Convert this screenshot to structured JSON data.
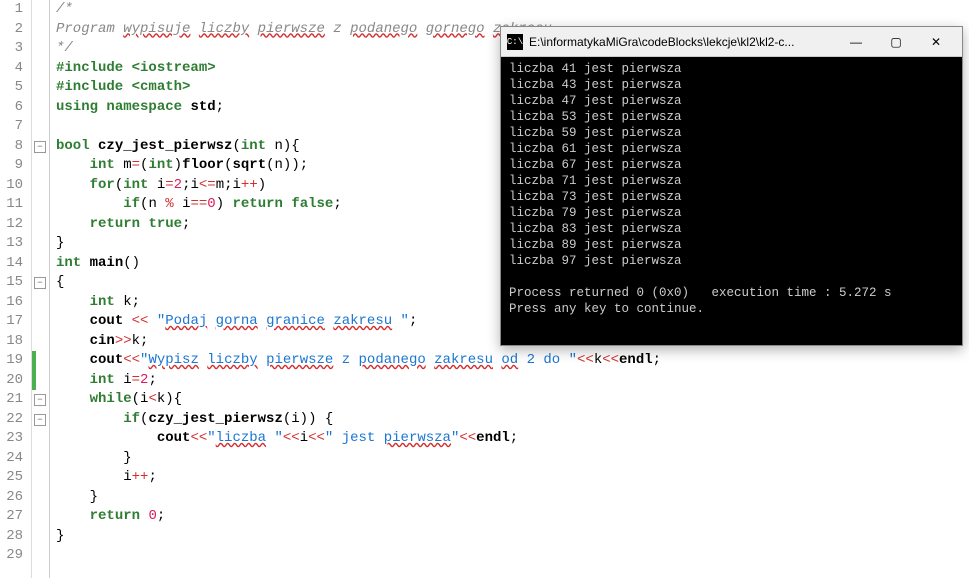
{
  "lines": [
    {
      "n": 1,
      "html": "<span class='c-comment'>/*</span>"
    },
    {
      "n": 2,
      "html": "<span class='c-comment'>Program <span class='c-spell'>wypisuje</span> <span class='c-spell'>liczby</span> <span class='c-spell'>pierwsze</span> z <span class='c-spell'>podanego</span> <span class='c-spell'>gornego</span> <span class='c-spell'>zakresu</span></span>"
    },
    {
      "n": 3,
      "html": "<span class='c-comment'>*/</span>"
    },
    {
      "n": 4,
      "html": "<span class='c-pre'>#include &lt;iostream&gt;</span>"
    },
    {
      "n": 5,
      "html": "<span class='c-pre'>#include &lt;cmath&gt;</span>"
    },
    {
      "n": 6,
      "html": "<span class='c-kw'>using</span> <span class='c-kw'>namespace</span> <span class='c-id' style='font-weight:bold'>std</span><span class='c-punc'>;</span>"
    },
    {
      "n": 7,
      "html": ""
    },
    {
      "n": 8,
      "fold": "⊟",
      "html": "<span class='c-kw'>bool</span> <span class='c-fn'>czy_jest_pierwsz</span><span class='c-punc'>(</span><span class='c-kw'>int</span> <span class='c-id'>n</span><span class='c-punc'>)</span><span class='c-punc'>{</span>"
    },
    {
      "n": 9,
      "html": "    <span class='c-kw'>int</span> <span class='c-id'>m</span><span class='c-op'>=</span><span class='c-punc'>(</span><span class='c-kw'>int</span><span class='c-punc'>)</span><span class='c-fn'>floor</span><span class='c-punc'>(</span><span class='c-fn'>sqrt</span><span class='c-punc'>(</span><span class='c-id'>n</span><span class='c-punc'>))</span><span class='c-punc'>;</span>"
    },
    {
      "n": 10,
      "html": "    <span class='c-kw'>for</span><span class='c-punc'>(</span><span class='c-kw'>int</span> <span class='c-id'>i</span><span class='c-op'>=</span><span class='c-num'>2</span><span class='c-punc'>;</span><span class='c-id'>i</span><span class='c-op'>&lt;=</span><span class='c-id'>m</span><span class='c-punc'>;</span><span class='c-id'>i</span><span class='c-op'>++</span><span class='c-punc'>)</span>"
    },
    {
      "n": 11,
      "html": "        <span class='c-kw'>if</span><span class='c-punc'>(</span><span class='c-id'>n</span> <span class='c-op'>%</span> <span class='c-id'>i</span><span class='c-op'>==</span><span class='c-num'>0</span><span class='c-punc'>)</span> <span class='c-kw'>return</span> <span class='c-kw'>false</span><span class='c-punc'>;</span>"
    },
    {
      "n": 12,
      "html": "    <span class='c-kw'>return</span> <span class='c-kw'>true</span><span class='c-punc'>;</span>"
    },
    {
      "n": 13,
      "html": "<span class='c-punc'>}</span>"
    },
    {
      "n": 14,
      "html": "<span class='c-kw'>int</span> <span class='c-fn'>main</span><span class='c-punc'>()</span>"
    },
    {
      "n": 15,
      "fold": "⊟",
      "html": "<span class='c-punc'>{</span>"
    },
    {
      "n": 16,
      "html": "    <span class='c-kw'>int</span> <span class='c-id'>k</span><span class='c-punc'>;</span>"
    },
    {
      "n": 17,
      "html": "    <span class='c-id' style='font-weight:bold'>cout</span> <span class='c-op'>&lt;&lt;</span> <span class='c-str'>&quot;<span class='c-spell'>Podaj</span> <span class='c-spell'>gorna</span> <span class='c-spell'>granice</span> <span class='c-spell'>zakresu</span> &quot;</span><span class='c-punc'>;</span>"
    },
    {
      "n": 18,
      "html": "    <span class='c-id' style='font-weight:bold'>cin</span><span class='c-op'>&gt;&gt;</span><span class='c-id'>k</span><span class='c-punc'>;</span>"
    },
    {
      "n": 19,
      "bar": true,
      "html": "    <span class='c-id' style='font-weight:bold'>cout</span><span class='c-op'>&lt;&lt;</span><span class='c-str'>&quot;<span class='c-spell'>Wypisz</span> <span class='c-spell'>liczby</span> <span class='c-spell'>pierwsze</span> z <span class='c-spell'>podanego</span> <span class='c-spell'>zakresu</span> <span class='c-spell'>od</span> 2 do &quot;</span><span class='c-op'>&lt;&lt;</span><span class='c-id'>k</span><span class='c-op'>&lt;&lt;</span><span class='c-id' style='font-weight:bold'>endl</span><span class='c-punc'>;</span>"
    },
    {
      "n": 20,
      "bar": true,
      "html": "    <span class='c-kw'>int</span> <span class='c-id'>i</span><span class='c-op'>=</span><span class='c-num'>2</span><span class='c-punc'>;</span>"
    },
    {
      "n": 21,
      "fold": "⊟",
      "html": "    <span class='c-kw'>while</span><span class='c-punc'>(</span><span class='c-id'>i</span><span class='c-op'>&lt;</span><span class='c-id'>k</span><span class='c-punc'>)</span><span class='c-punc'>{</span>"
    },
    {
      "n": 22,
      "fold": "⊟",
      "html": "        <span class='c-kw'>if</span><span class='c-punc'>(</span><span class='c-fn'>czy_jest_pierwsz</span><span class='c-punc'>(</span><span class='c-id'>i</span><span class='c-punc'>))</span> <span class='c-punc'>{</span>"
    },
    {
      "n": 23,
      "html": "            <span class='c-id' style='font-weight:bold'>cout</span><span class='c-op'>&lt;&lt;</span><span class='c-str'>&quot;<span class='c-spell'>liczba</span> &quot;</span><span class='c-op'>&lt;&lt;</span><span class='c-id'>i</span><span class='c-op'>&lt;&lt;</span><span class='c-str'>&quot; jest <span class='c-spell'>pierwsza</span>&quot;</span><span class='c-op'>&lt;&lt;</span><span class='c-id' style='font-weight:bold'>endl</span><span class='c-punc'>;</span>"
    },
    {
      "n": 24,
      "html": "        <span class='c-punc'>}</span>"
    },
    {
      "n": 25,
      "html": "        <span class='c-id'>i</span><span class='c-op'>++</span><span class='c-punc'>;</span>"
    },
    {
      "n": 26,
      "html": "    <span class='c-punc'>}</span>"
    },
    {
      "n": 27,
      "html": "    <span class='c-kw'>return</span> <span class='c-num'>0</span><span class='c-punc'>;</span>"
    },
    {
      "n": 28,
      "html": "<span class='c-punc'>}</span>"
    },
    {
      "n": 29,
      "html": ""
    }
  ],
  "console": {
    "title": "E:\\informatykaMiGra\\codeBlocks\\lekcje\\kl2\\kl2-c...",
    "output_lines": [
      "liczba 41 jest pierwsza",
      "liczba 43 jest pierwsza",
      "liczba 47 jest pierwsza",
      "liczba 53 jest pierwsza",
      "liczba 59 jest pierwsza",
      "liczba 61 jest pierwsza",
      "liczba 67 jest pierwsza",
      "liczba 71 jest pierwsza",
      "liczba 73 jest pierwsza",
      "liczba 79 jest pierwsza",
      "liczba 83 jest pierwsza",
      "liczba 89 jest pierwsza",
      "liczba 97 jest pierwsza",
      "",
      "Process returned 0 (0x0)   execution time : 5.272 s",
      "Press any key to continue."
    ],
    "buttons": {
      "min": "—",
      "max": "▢",
      "close": "✕"
    },
    "icon": "C:\\"
  }
}
